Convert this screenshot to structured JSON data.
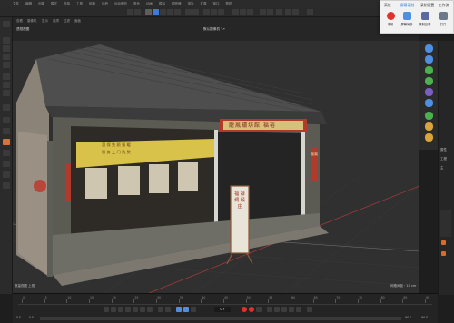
{
  "menubar": {
    "items": [
      "文件",
      "编辑",
      "创建",
      "模式",
      "选择",
      "工具",
      "网格",
      "体积",
      "运动图形",
      "角色",
      "动画",
      "模拟",
      "跟踪器",
      "渲染",
      "扩展",
      "窗口",
      "帮助"
    ]
  },
  "view_menu": [
    "查看",
    "摄像机",
    "显示",
    "选项",
    "过滤",
    "面板"
  ],
  "viewport": {
    "camera_label": "默认摄像机 °↗",
    "view_label": "透视视图",
    "bottom_left": "数量视图  上视",
    "bottom_right": "网格间距 : 10 cm"
  },
  "scene": {
    "banner_top": "龍鳳繡坊館 福裕",
    "banner_side": "龍鳳",
    "yellow_awning_lines": [
      "温 保 免 顾 留 暖",
      "服 务 上 门 洗 熨"
    ],
    "standee_text": "福 禄 绸 缎 庄"
  },
  "popup": {
    "tabs": [
      "高效",
      "屏幕录制",
      "录制设置",
      "工作流"
    ],
    "buttons": [
      {
        "label": "录制"
      },
      {
        "label": "屏幕局部"
      },
      {
        "label": "录制区域"
      },
      {
        "label": "打开"
      }
    ]
  },
  "timeline": {
    "ruler_labels": [
      "0",
      "5",
      "10",
      "15",
      "20",
      "25",
      "30",
      "35",
      "40",
      "45",
      "50",
      "55",
      "60",
      "65",
      "70",
      "75",
      "80",
      "85",
      "90"
    ],
    "current_frame": "0 F",
    "range_start": "0 F",
    "range_start2": "0 F",
    "range_end": "90 F",
    "range_end2": "90 F"
  },
  "right_panel": {
    "labels": [
      "属性",
      "工程",
      "主"
    ]
  },
  "colors": {
    "accent": "#3e7bd6",
    "record_red": "#e0322b",
    "selection_green": "#4caf50"
  }
}
